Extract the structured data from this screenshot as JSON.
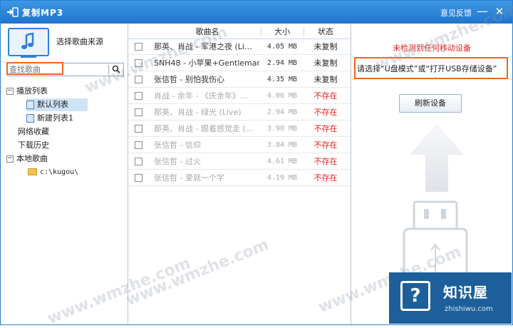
{
  "window": {
    "title": "复制MP3",
    "feedback": "意见反馈",
    "minimize": "—",
    "close": "✕"
  },
  "sidebar": {
    "source_label": "选择歌曲来源",
    "search_placeholder": "查找歌曲",
    "tree": [
      {
        "label": "播放列表",
        "toggle": "−"
      },
      {
        "label": "默认列表"
      },
      {
        "label": "新建列表1"
      },
      {
        "label": "网络收藏"
      },
      {
        "label": "下载历史"
      },
      {
        "label": "本地歌曲",
        "toggle": "−"
      },
      {
        "label": "c:\\kugou\\"
      }
    ]
  },
  "table": {
    "headers": {
      "name": "歌曲名",
      "size": "大小",
      "status": "状态"
    },
    "rows": [
      {
        "name": "那英、肖战 - 军港之夜 (Li…",
        "size": "4.05 MB",
        "status": "未复制",
        "state": "active"
      },
      {
        "name": "SNH48 - 小苹果+Gentleman…",
        "size": "2.94 MB",
        "status": "未复制",
        "state": "active"
      },
      {
        "name": "张信哲 - 别怕我伤心",
        "size": "4.35 MB",
        "status": "未复制",
        "state": "active"
      },
      {
        "name": "肖战 - 余年 - 《庆余年》…",
        "size": "4.06 MB",
        "status": "不存在",
        "state": "missing"
      },
      {
        "name": "那英、肖战 - 绿光 (Live)",
        "size": "2.94 MB",
        "status": "不存在",
        "state": "missing"
      },
      {
        "name": "那英、肖战 - 跟着感觉走 (…",
        "size": "3.90 MB",
        "status": "不存在",
        "state": "missing"
      },
      {
        "name": "张信哲 - 信仰",
        "size": "3.84 MB",
        "status": "不存在",
        "state": "missing"
      },
      {
        "name": "张信哲 - 过火",
        "size": "4.61 MB",
        "status": "不存在",
        "state": "missing"
      },
      {
        "name": "张信哲 - 爱就一个字",
        "size": "4.19 MB",
        "status": "不存在",
        "state": "missing"
      }
    ]
  },
  "device": {
    "warning": "未检测到任何移动设备",
    "hint": "请选择“U盘模式”或“打开USB存储设备”",
    "refresh_label": "刷新设备"
  },
  "badge": {
    "icon_glyph": "?",
    "title": "知识屋",
    "subtitle": "zhishiwu.com"
  },
  "watermark": "www.wmzhe.com",
  "colors": {
    "titlebar": "#2b84d8",
    "missing_status": "#e02020",
    "highlight_border": "#f26522",
    "badge_bg": "#1c5f9a"
  }
}
